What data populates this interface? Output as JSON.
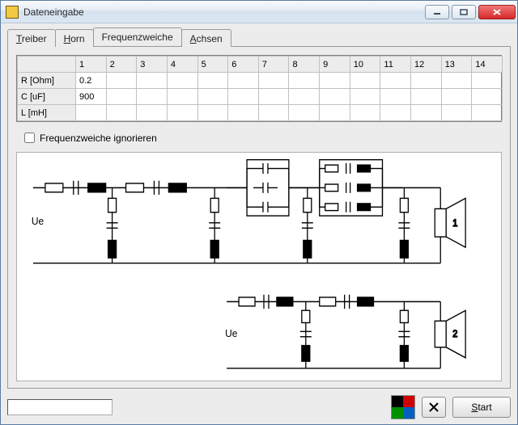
{
  "window": {
    "title": "Dateneingabe"
  },
  "tabs": {
    "treiber": "Treiber",
    "treiber_accel": "T",
    "horn": "Horn",
    "horn_accel": "H",
    "freq": "Frequenzweiche",
    "achsen": "Achsen",
    "achsen_accel": "A"
  },
  "grid": {
    "col_headers": [
      "1",
      "2",
      "3",
      "4",
      "5",
      "6",
      "7",
      "8",
      "9",
      "10",
      "11",
      "12",
      "13",
      "14"
    ],
    "rows": [
      {
        "label": "R [Ohm]",
        "values": [
          "0.2",
          "",
          "",
          "",
          "",
          "",
          "",
          "",
          "",
          "",
          "",
          "",
          "",
          ""
        ]
      },
      {
        "label": "C [uF]",
        "values": [
          "900",
          "",
          "",
          "",
          "",
          "",
          "",
          "",
          "",
          "",
          "",
          "",
          "",
          ""
        ]
      },
      {
        "label": "L [mH]",
        "values": [
          "",
          "",
          "",
          "",
          "",
          "",
          "",
          "",
          "",
          "",
          "",
          "",
          "",
          ""
        ]
      }
    ],
    "editing_row": 2,
    "editing_col": 0
  },
  "checkbox": {
    "label": "Frequenzweiche ignorieren",
    "checked": false
  },
  "schematic": {
    "ue_label": "Ue",
    "speaker1": "1",
    "speaker2": "2"
  },
  "colors": {
    "tl": "#000000",
    "tr": "#d00000",
    "bl": "#009000",
    "br": "#0060c0"
  },
  "buttons": {
    "close": "✕",
    "start": "Start",
    "start_accel": "S"
  }
}
